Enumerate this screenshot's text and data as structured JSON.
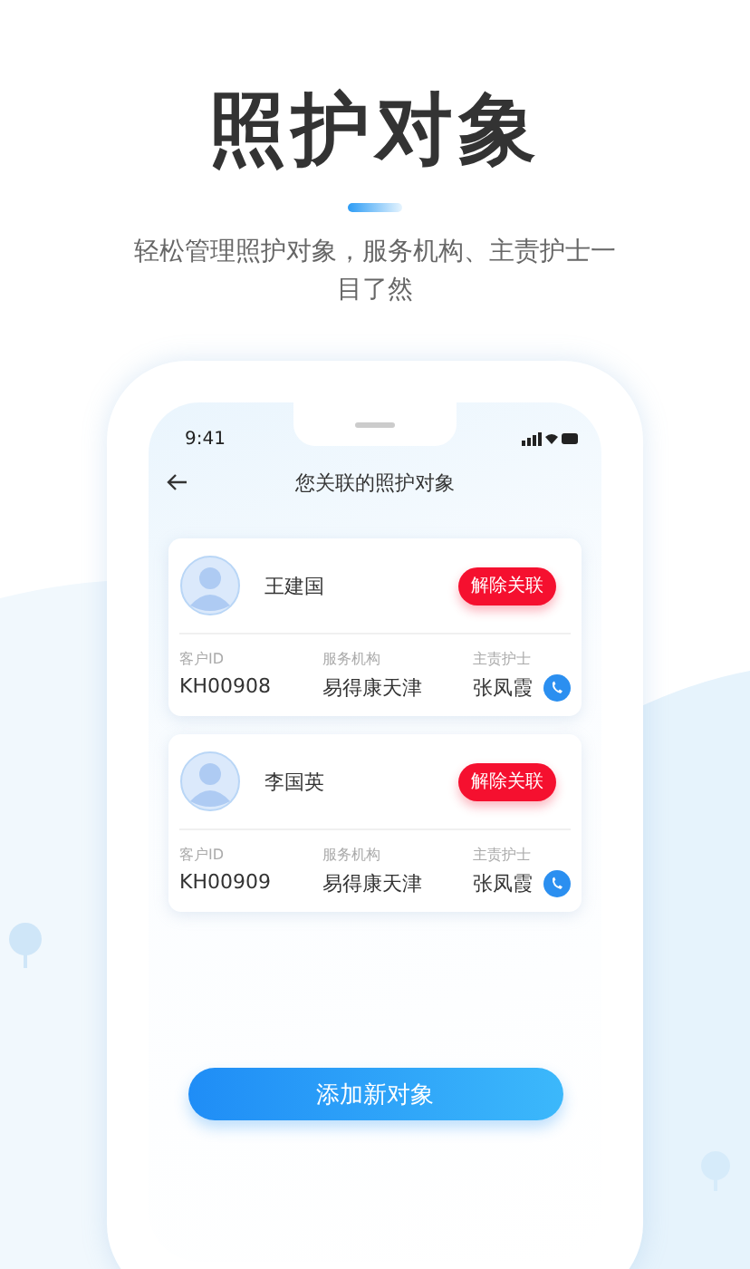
{
  "header": {
    "title": "照护对象",
    "subtitle": "轻松管理照护对象，服务机构、主责护士一目了然"
  },
  "status_bar": {
    "time": "9:41"
  },
  "nav": {
    "title": "您关联的照护对象"
  },
  "cards": [
    {
      "name": "王建国",
      "action": "解除关联",
      "fields": [
        {
          "kind": "text",
          "label": "客户ID",
          "value": "KH00908"
        },
        {
          "kind": "text",
          "label": "服务机构",
          "value": "易得康天津"
        },
        {
          "kind": "contact",
          "label": "主责护士",
          "value": "张凤霞"
        }
      ]
    },
    {
      "name": "李国英",
      "action": "解除关联",
      "fields": [
        {
          "kind": "text",
          "label": "客户ID",
          "value": "KH00909"
        },
        {
          "kind": "text",
          "label": "服务机构",
          "value": "易得康天津"
        },
        {
          "kind": "contact",
          "label": "主责护士",
          "value": "张凤霞"
        }
      ]
    }
  ],
  "primary_button": {
    "label": "添加新对象"
  }
}
